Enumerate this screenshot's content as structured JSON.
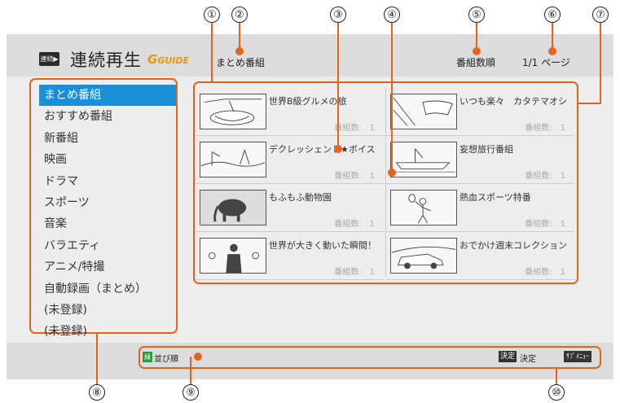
{
  "header": {
    "app_icon_label": "連続▶",
    "title": "連続再生",
    "gguide_logo": "GUIDE",
    "breadcrumb": "まとめ番組",
    "sort_label": "番組数順",
    "page_indicator": "1/1 ページ"
  },
  "menu": {
    "items": [
      {
        "label": "まとめ番組",
        "selected": true
      },
      {
        "label": "おすすめ番組"
      },
      {
        "label": "新番組"
      },
      {
        "label": "映画"
      },
      {
        "label": "ドラマ"
      },
      {
        "label": "スポーツ"
      },
      {
        "label": "音楽"
      },
      {
        "label": "バラエティ"
      },
      {
        "label": "アニメ/特撮"
      },
      {
        "label": "自動録画（まとめ）"
      },
      {
        "label": "(未登録)"
      },
      {
        "label": "(未登録)"
      }
    ]
  },
  "grid": {
    "tiles": [
      {
        "title": "世界B級グルメの旅",
        "count": "番組数:　1",
        "thumb": "food-thumbnail"
      },
      {
        "title": "いつも楽々　カタテマオシ",
        "count": "番組数:　1",
        "thumb": "cleaning-thumbnail"
      },
      {
        "title": "デクレッシェンド★ボイス",
        "count": "番組数:　1",
        "thumb": "landscape-thumbnail"
      },
      {
        "title": "妄想旅行番組",
        "count": "番組数:　1",
        "thumb": "ship-thumbnail"
      },
      {
        "title": "もふもふ動物園",
        "count": "番組数:　1",
        "thumb": "elephant-thumbnail"
      },
      {
        "title": "熱血スポーツ特番",
        "count": "番組数:　1",
        "thumb": "tennis-thumbnail"
      },
      {
        "title": "世界が大きく動いた瞬間！",
        "count": "番組数:　1",
        "thumb": "speech-thumbnail"
      },
      {
        "title": "おでかけ週末コレクション",
        "count": "番組数:　1",
        "thumb": "car-thumbnail"
      }
    ]
  },
  "footer": {
    "green_key": "緑",
    "sort_hint": "並び順",
    "enter_key": "決定",
    "enter_hint": "決定",
    "submenu_key": "ｻﾌﾞﾒﾆｭｰ"
  },
  "callouts": [
    "①",
    "②",
    "③",
    "④",
    "⑤",
    "⑥",
    "⑦",
    "⑧",
    "⑨",
    "⑩"
  ],
  "colors": {
    "accent": "#e2641d",
    "selection": "#1a8fd8",
    "green_key": "#2a9a3a"
  }
}
